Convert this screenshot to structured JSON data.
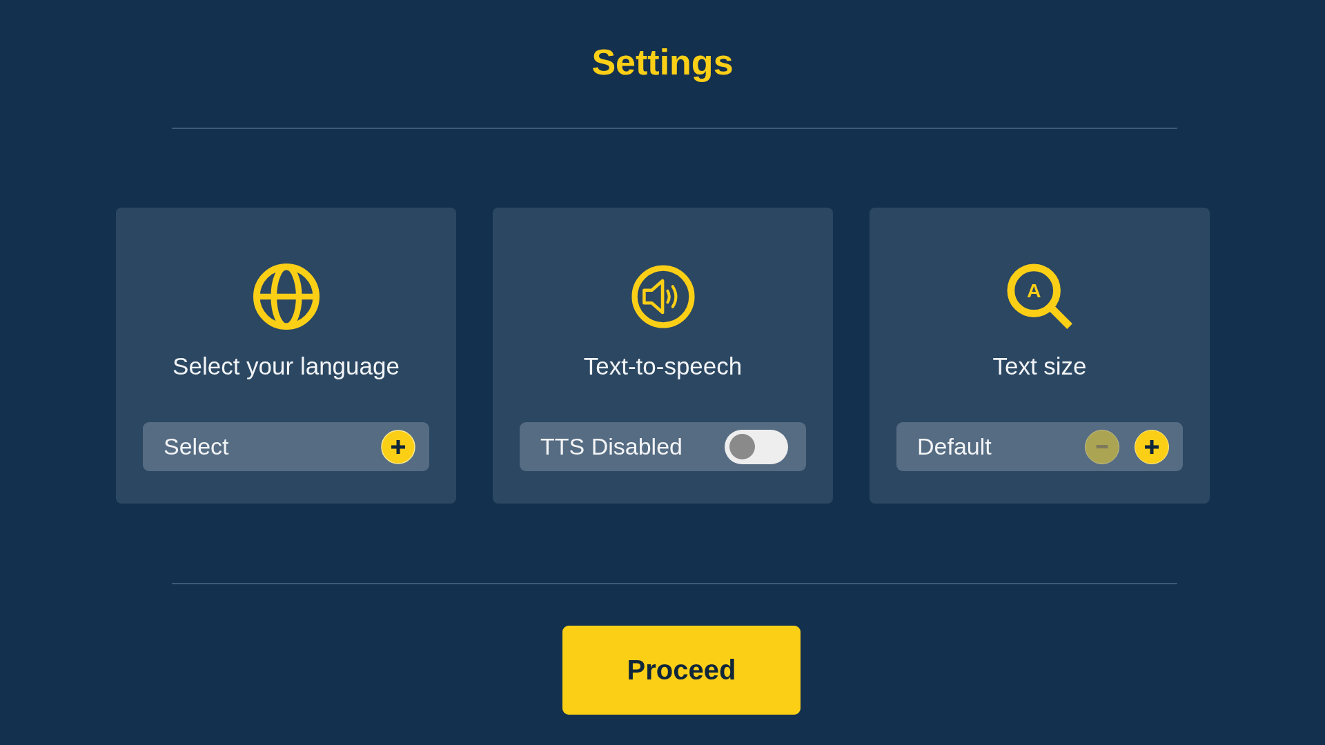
{
  "title": "Settings",
  "cards": [
    {
      "kind": "select",
      "label": "Select your language",
      "value": "Select"
    },
    {
      "kind": "toggle",
      "label": "Text-to-speech",
      "status": "TTS Disabled",
      "on": false
    },
    {
      "kind": "stepper",
      "label": "Text size",
      "icon_letter": "A",
      "value": "Default",
      "decrease": {
        "disabled": true
      },
      "increase": {
        "disabled": false
      }
    }
  ],
  "proceed": {
    "label": "Proceed"
  }
}
